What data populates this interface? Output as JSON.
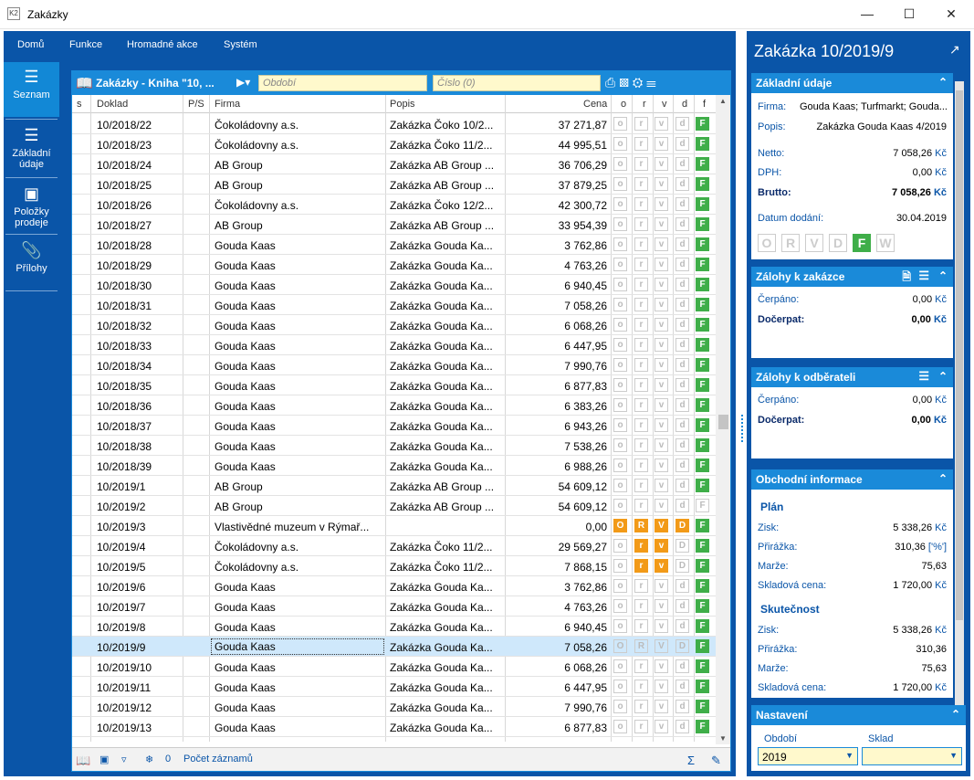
{
  "window": {
    "title": "Zakázky",
    "app_icon": "K2"
  },
  "menu": [
    "Domů",
    "Funkce",
    "Hromadné akce",
    "Systém"
  ],
  "nav": [
    {
      "label": "Seznam",
      "icon": "hamburger-icon"
    },
    {
      "label": "Základní údaje",
      "icon": "list-icon"
    },
    {
      "label": "Položky prodeje",
      "icon": "box-icon"
    },
    {
      "label": "Přílohy",
      "icon": "paperclip-icon"
    }
  ],
  "list": {
    "title": "Zakázky - Kniha \"10, ...",
    "period_placeholder": "Období",
    "number_placeholder": "Číslo (0)",
    "columns": {
      "s": "s",
      "doklad": "Doklad",
      "ps": "P/S",
      "firma": "Firma",
      "popis": "Popis",
      "cena": "Cena",
      "o": "o",
      "r": "r",
      "v": "v",
      "d": "d",
      "f": "f"
    },
    "rows": [
      {
        "doklad": "10/2018/22",
        "firma": "Čokoládovny a.s.",
        "popis": "Zakázka Čoko 10/2...",
        "cena": "37 271,87",
        "flags": [
          "o",
          "r",
          "v",
          "d",
          "F"
        ],
        "on": [
          0,
          0,
          0,
          0,
          1
        ]
      },
      {
        "doklad": "10/2018/23",
        "firma": "Čokoládovny a.s.",
        "popis": "Zakázka Čoko 11/2...",
        "cena": "44 995,51",
        "flags": [
          "o",
          "r",
          "v",
          "d",
          "F"
        ],
        "on": [
          0,
          0,
          0,
          0,
          1
        ]
      },
      {
        "doklad": "10/2018/24",
        "firma": "AB Group",
        "popis": "Zakázka AB Group ...",
        "cena": "36 706,29",
        "flags": [
          "o",
          "r",
          "v",
          "d",
          "F"
        ],
        "on": [
          0,
          0,
          0,
          0,
          1
        ]
      },
      {
        "doklad": "10/2018/25",
        "firma": "AB Group",
        "popis": "Zakázka AB Group ...",
        "cena": "37 879,25",
        "flags": [
          "o",
          "r",
          "v",
          "d",
          "F"
        ],
        "on": [
          0,
          0,
          0,
          0,
          1
        ]
      },
      {
        "doklad": "10/2018/26",
        "firma": "Čokoládovny a.s.",
        "popis": "Zakázka Čoko 12/2...",
        "cena": "42 300,72",
        "flags": [
          "o",
          "r",
          "v",
          "d",
          "F"
        ],
        "on": [
          0,
          0,
          0,
          0,
          1
        ]
      },
      {
        "doklad": "10/2018/27",
        "firma": "AB Group",
        "popis": "Zakázka AB Group ...",
        "cena": "33 954,39",
        "flags": [
          "o",
          "r",
          "v",
          "d",
          "F"
        ],
        "on": [
          0,
          0,
          0,
          0,
          1
        ]
      },
      {
        "doklad": "10/2018/28",
        "firma": "Gouda Kaas",
        "popis": "Zakázka Gouda Ka...",
        "cena": "3 762,86",
        "flags": [
          "o",
          "r",
          "v",
          "d",
          "F"
        ],
        "on": [
          0,
          0,
          0,
          0,
          1
        ]
      },
      {
        "doklad": "10/2018/29",
        "firma": "Gouda Kaas",
        "popis": "Zakázka Gouda Ka...",
        "cena": "4 763,26",
        "flags": [
          "o",
          "r",
          "v",
          "d",
          "F"
        ],
        "on": [
          0,
          0,
          0,
          0,
          1
        ]
      },
      {
        "doklad": "10/2018/30",
        "firma": "Gouda Kaas",
        "popis": "Zakázka Gouda Ka...",
        "cena": "6 940,45",
        "flags": [
          "o",
          "r",
          "v",
          "d",
          "F"
        ],
        "on": [
          0,
          0,
          0,
          0,
          1
        ]
      },
      {
        "doklad": "10/2018/31",
        "firma": "Gouda Kaas",
        "popis": "Zakázka Gouda Ka...",
        "cena": "7 058,26",
        "flags": [
          "o",
          "r",
          "v",
          "d",
          "F"
        ],
        "on": [
          0,
          0,
          0,
          0,
          1
        ]
      },
      {
        "doklad": "10/2018/32",
        "firma": "Gouda Kaas",
        "popis": "Zakázka Gouda Ka...",
        "cena": "6 068,26",
        "flags": [
          "o",
          "r",
          "v",
          "d",
          "F"
        ],
        "on": [
          0,
          0,
          0,
          0,
          1
        ]
      },
      {
        "doklad": "10/2018/33",
        "firma": "Gouda Kaas",
        "popis": "Zakázka Gouda Ka...",
        "cena": "6 447,95",
        "flags": [
          "o",
          "r",
          "v",
          "d",
          "F"
        ],
        "on": [
          0,
          0,
          0,
          0,
          1
        ]
      },
      {
        "doklad": "10/2018/34",
        "firma": "Gouda Kaas",
        "popis": "Zakázka Gouda Ka...",
        "cena": "7 990,76",
        "flags": [
          "o",
          "r",
          "v",
          "d",
          "F"
        ],
        "on": [
          0,
          0,
          0,
          0,
          1
        ]
      },
      {
        "doklad": "10/2018/35",
        "firma": "Gouda Kaas",
        "popis": "Zakázka Gouda Ka...",
        "cena": "6 877,83",
        "flags": [
          "o",
          "r",
          "v",
          "d",
          "F"
        ],
        "on": [
          0,
          0,
          0,
          0,
          1
        ]
      },
      {
        "doklad": "10/2018/36",
        "firma": "Gouda Kaas",
        "popis": "Zakázka Gouda Ka...",
        "cena": "6 383,26",
        "flags": [
          "o",
          "r",
          "v",
          "d",
          "F"
        ],
        "on": [
          0,
          0,
          0,
          0,
          1
        ]
      },
      {
        "doklad": "10/2018/37",
        "firma": "Gouda Kaas",
        "popis": "Zakázka Gouda Ka...",
        "cena": "6 943,26",
        "flags": [
          "o",
          "r",
          "v",
          "d",
          "F"
        ],
        "on": [
          0,
          0,
          0,
          0,
          1
        ]
      },
      {
        "doklad": "10/2018/38",
        "firma": "Gouda Kaas",
        "popis": "Zakázka Gouda Ka...",
        "cena": "7 538,26",
        "flags": [
          "o",
          "r",
          "v",
          "d",
          "F"
        ],
        "on": [
          0,
          0,
          0,
          0,
          1
        ]
      },
      {
        "doklad": "10/2018/39",
        "firma": "Gouda Kaas",
        "popis": "Zakázka Gouda Ka...",
        "cena": "6 988,26",
        "flags": [
          "o",
          "r",
          "v",
          "d",
          "F"
        ],
        "on": [
          0,
          0,
          0,
          0,
          1
        ]
      },
      {
        "doklad": "10/2019/1",
        "firma": "AB Group",
        "popis": "Zakázka AB Group ...",
        "cena": "54 609,12",
        "flags": [
          "o",
          "r",
          "v",
          "d",
          "F"
        ],
        "on": [
          0,
          0,
          0,
          0,
          1
        ]
      },
      {
        "doklad": "10/2019/2",
        "firma": "AB Group",
        "popis": "Zakázka AB Group ...",
        "cena": "54 609,12",
        "flags": [
          "o",
          "r",
          "v",
          "d",
          "F"
        ],
        "on": [
          0,
          0,
          0,
          0,
          0
        ]
      },
      {
        "doklad": "10/2019/3",
        "firma": "Vlastivědné muzeum v Rýmař...",
        "popis": "",
        "cena": "0,00",
        "flags": [
          "O",
          "R",
          "V",
          "D",
          "F"
        ],
        "on": [
          2,
          2,
          2,
          2,
          1
        ]
      },
      {
        "doklad": "10/2019/4",
        "firma": "Čokoládovny a.s.",
        "popis": "Zakázka Čoko 11/2...",
        "cena": "29 569,27",
        "flags": [
          "o",
          "r",
          "v",
          "D",
          "F"
        ],
        "on": [
          0,
          2,
          2,
          0,
          1
        ]
      },
      {
        "doklad": "10/2019/5",
        "firma": "Čokoládovny a.s.",
        "popis": "Zakázka Čoko 11/2...",
        "cena": "7 868,15",
        "flags": [
          "o",
          "r",
          "v",
          "D",
          "F"
        ],
        "on": [
          0,
          2,
          2,
          0,
          1
        ]
      },
      {
        "doklad": "10/2019/6",
        "firma": "Gouda Kaas",
        "popis": "Zakázka Gouda Ka...",
        "cena": "3 762,86",
        "flags": [
          "o",
          "r",
          "v",
          "d",
          "F"
        ],
        "on": [
          0,
          0,
          0,
          0,
          1
        ]
      },
      {
        "doklad": "10/2019/7",
        "firma": "Gouda Kaas",
        "popis": "Zakázka Gouda Ka...",
        "cena": "4 763,26",
        "flags": [
          "o",
          "r",
          "v",
          "d",
          "F"
        ],
        "on": [
          0,
          0,
          0,
          0,
          1
        ]
      },
      {
        "doklad": "10/2019/8",
        "firma": "Gouda Kaas",
        "popis": "Zakázka Gouda Ka...",
        "cena": "6 940,45",
        "flags": [
          "o",
          "r",
          "v",
          "d",
          "F"
        ],
        "on": [
          0,
          0,
          0,
          0,
          1
        ]
      },
      {
        "doklad": "10/2019/9",
        "firma": "Gouda Kaas",
        "popis": "Zakázka Gouda Ka...",
        "cena": "7 058,26",
        "flags": [
          "O",
          "R",
          "V",
          "D",
          "F"
        ],
        "on": [
          0,
          0,
          0,
          0,
          1
        ],
        "selected": true
      },
      {
        "doklad": "10/2019/10",
        "firma": "Gouda Kaas",
        "popis": "Zakázka Gouda Ka...",
        "cena": "6 068,26",
        "flags": [
          "o",
          "r",
          "v",
          "d",
          "F"
        ],
        "on": [
          0,
          0,
          0,
          0,
          1
        ]
      },
      {
        "doklad": "10/2019/11",
        "firma": "Gouda Kaas",
        "popis": "Zakázka Gouda Ka...",
        "cena": "6 447,95",
        "flags": [
          "o",
          "r",
          "v",
          "d",
          "F"
        ],
        "on": [
          0,
          0,
          0,
          0,
          1
        ]
      },
      {
        "doklad": "10/2019/12",
        "firma": "Gouda Kaas",
        "popis": "Zakázka Gouda Ka...",
        "cena": "7 990,76",
        "flags": [
          "o",
          "r",
          "v",
          "d",
          "F"
        ],
        "on": [
          0,
          0,
          0,
          0,
          1
        ]
      },
      {
        "doklad": "10/2019/13",
        "firma": "Gouda Kaas",
        "popis": "Zakázka Gouda Ka...",
        "cena": "6 877,83",
        "flags": [
          "o",
          "r",
          "v",
          "d",
          "F"
        ],
        "on": [
          0,
          0,
          0,
          0,
          1
        ]
      }
    ],
    "footer": {
      "count": "0",
      "count_label": "Počet záznamů"
    }
  },
  "detail": {
    "title": "Zakázka 10/2019/9",
    "basic": {
      "header": "Základní údaje",
      "firma_label": "Firma:",
      "firma_value": "Gouda Kaas; Turfmarkt; Gouda...",
      "popis_label": "Popis:",
      "popis_value": "Zakázka Gouda Kaas 4/2019",
      "netto_label": "Netto:",
      "netto_value": "7 058,26",
      "netto_cur": "Kč",
      "dph_label": "DPH:",
      "dph_value": "0,00",
      "dph_cur": "Kč",
      "brutto_label": "Brutto:",
      "brutto_value": "7 058,26",
      "brutto_cur": "Kč",
      "datum_label": "Datum dodání:",
      "datum_value": "30.04.2019",
      "flags": [
        "O",
        "R",
        "V",
        "D",
        "F",
        "W"
      ]
    },
    "zalohy_zakazka": {
      "header": "Zálohy k zakázce",
      "cerpano_label": "Čerpáno:",
      "cerpano_value": "0,00",
      "docerpat_label": "Dočerpat:",
      "docerpat_value": "0,00",
      "cur": "Kč"
    },
    "zalohy_odberatel": {
      "header": "Zálohy k odběrateli",
      "cerpano_label": "Čerpáno:",
      "cerpano_value": "0,00",
      "docerpat_label": "Dočerpat:",
      "docerpat_value": "0,00",
      "cur": "Kč"
    },
    "obchodni": {
      "header": "Obchodní informace",
      "plan_label": "Plán",
      "plan": {
        "zisk_label": "Zisk:",
        "zisk": "5 338,26",
        "prirazka_label": "Přirážka:",
        "prirazka": "310,36",
        "prirazka_unit": "['%']",
        "marze_label": "Marže:",
        "marze": "75,63",
        "skladova_label": "Skladová cena:",
        "skladova": "1 720,00"
      },
      "skut_label": "Skutečnost",
      "skut": {
        "zisk_label": "Zisk:",
        "zisk": "5 338,26",
        "prirazka_label": "Přirážka:",
        "prirazka": "310,36",
        "marze_label": "Marže:",
        "marze": "75,63",
        "skladova_label": "Skladová cena:",
        "skladova": "1 720,00"
      },
      "cur": "Kč"
    },
    "nastaveni": {
      "header": "Nastavení",
      "obdobi_label": "Období",
      "obdobi_value": "2019",
      "sklad_label": "Sklad",
      "sklad_value": ""
    }
  }
}
